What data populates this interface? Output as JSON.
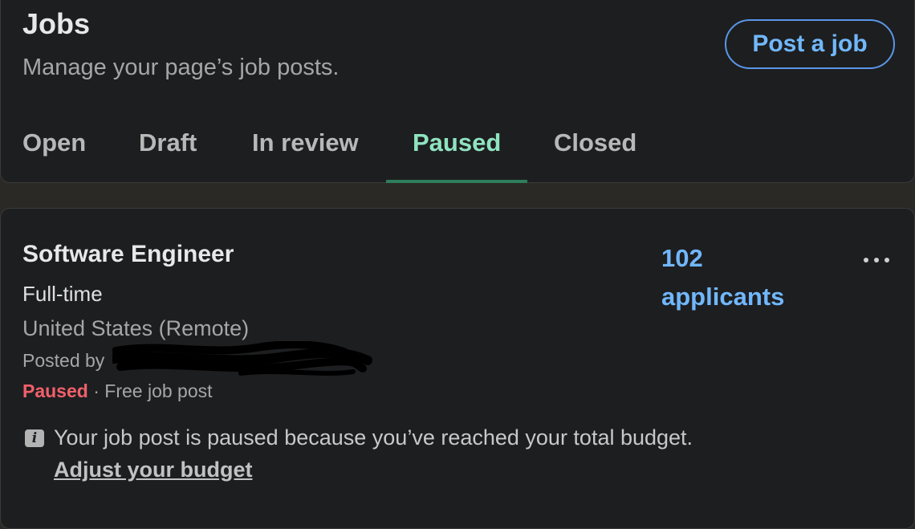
{
  "header": {
    "title": "Jobs",
    "subtitle": "Manage your page’s job posts.",
    "post_job_label": "Post a job"
  },
  "tabs": [
    {
      "label": "Open",
      "active": false
    },
    {
      "label": "Draft",
      "active": false
    },
    {
      "label": "In review",
      "active": false
    },
    {
      "label": "Paused",
      "active": true
    },
    {
      "label": "Closed",
      "active": false
    }
  ],
  "job": {
    "title": "Software Engineer",
    "type": "Full-time",
    "location": "United States (Remote)",
    "posted_by_prefix": "Posted by",
    "status": "Paused",
    "separator": " · ",
    "post_kind": "Free job post",
    "applicants_count": "102",
    "applicants_label": "applicants",
    "notice": "Your job post is paused because you’ve reached your total budget.",
    "adjust_link": "Adjust your budget"
  },
  "icons": {
    "info": "info-icon",
    "more": "more-options-icon"
  },
  "colors": {
    "background": "#1d1e20",
    "page_gap": "#2b2925",
    "accent_blue": "#71b7fb",
    "active_tab": "#8fe3c0",
    "tab_underline": "#2e7d5b",
    "paused_red": "#f2606b"
  }
}
